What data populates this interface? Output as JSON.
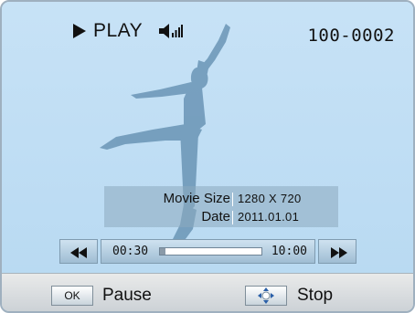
{
  "status": {
    "mode_label": "PLAY",
    "mode_icon": "play-icon",
    "volume_icon": "volume-icon",
    "file_number": "100-0002"
  },
  "info": {
    "movie_size_label": "Movie Size",
    "movie_size_value": "1280 X 720",
    "date_label": "Date",
    "date_value": "2011.01.01"
  },
  "playback": {
    "current_time": "00:30",
    "total_time": "10:00",
    "progress_fraction": 0.05,
    "rewind_icon": "rewind-icon",
    "fast_forward_icon": "fast-forward-icon"
  },
  "softkeys": {
    "ok_label": "OK",
    "pause_label": "Pause",
    "nav_icon": "dpad-icon",
    "stop_label": "Stop"
  }
}
